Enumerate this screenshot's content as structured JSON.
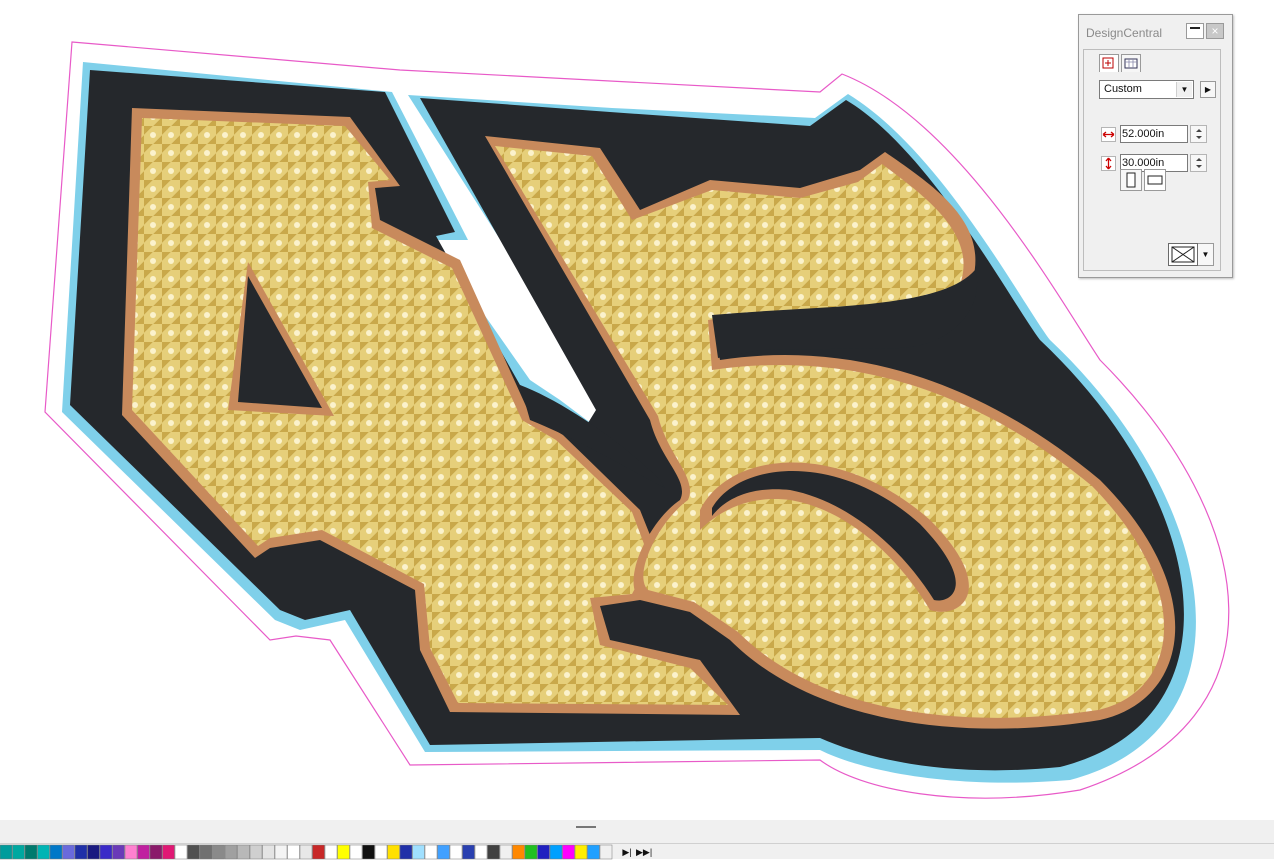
{
  "panel": {
    "title": "DesignCentral",
    "close_glyph": "×",
    "preset_value": "Custom",
    "width_value": "52.000in",
    "height_value": "30.000in"
  },
  "icons": {
    "minimize": "minimize-icon",
    "close": "close-icon",
    "width": "width-dimension-icon",
    "height": "height-dimension-icon",
    "portrait": "portrait-icon",
    "landscape": "landscape-icon",
    "fill": "no-fill-icon",
    "dropdown": "chevron-down-icon",
    "more": "chevron-right-icon"
  },
  "artwork": {
    "colors": {
      "cut_line": "#e85ac8",
      "outer_outline": "#7fd0ea",
      "shadow": "#25282c",
      "inner_outline": "#c88a5c",
      "fill_light": "#f1e3a4",
      "fill_dark": "#c9a84a"
    }
  },
  "palette": {
    "swatches": [
      "#009c9c",
      "#00a8a0",
      "#007a6e",
      "#00b4b4",
      "#0078c8",
      "#6a6adc",
      "#2030a8",
      "#1a1a80",
      "#3a2ac8",
      "#6a3ab8",
      "#ff80d0",
      "#c020a0",
      "#8a1a6a",
      "#e01874",
      "#ffffff",
      "#505050",
      "#707070",
      "#8a8a8a",
      "#a0a0a0",
      "#b8b8b8",
      "#cfcfcf",
      "#e4e4e4",
      "#f4f4f4",
      "#ffffff",
      "#e8e8e8",
      "#c82828",
      "#ffffff",
      "#ffff00",
      "#ffffff",
      "#101010",
      "#ffffff",
      "#ffe000",
      "#2030a8",
      "#a0e0ff",
      "#ffffff",
      "#40a0ff",
      "#ffffff",
      "#2a40b0",
      "#ffffff",
      "#404040",
      "#f0f0f0",
      "#ff8800",
      "#20c020",
      "#2020c0",
      "#00a0ff",
      "#ff00ff",
      "#ffee00",
      "#20a0ff",
      "#f0f0f0"
    ]
  }
}
